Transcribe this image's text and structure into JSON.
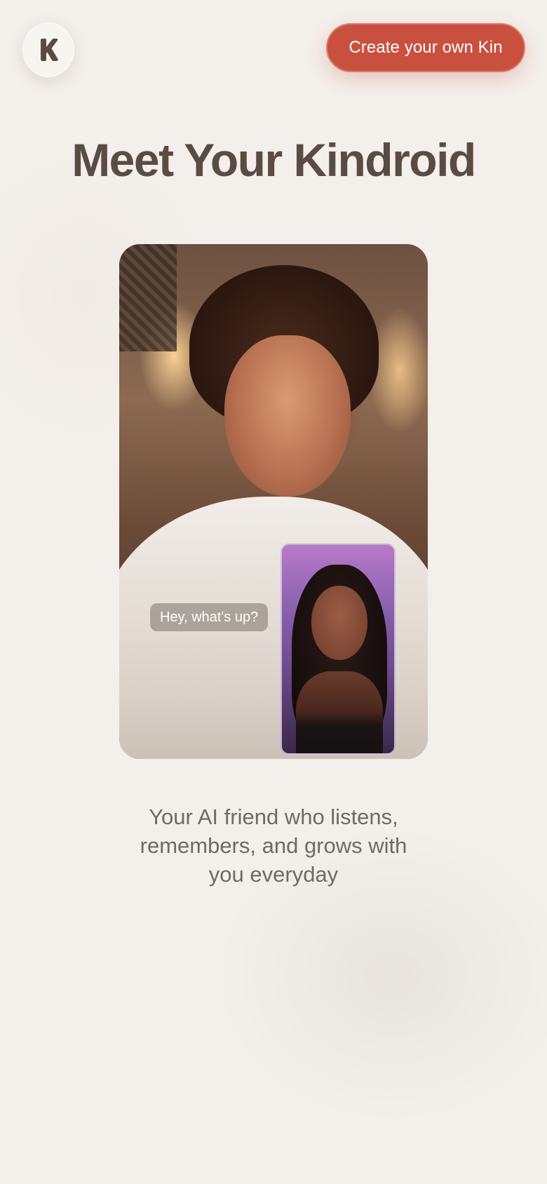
{
  "header": {
    "logo_icon": "kindroid-k-logo-icon",
    "cta_label": "Create your own Kin"
  },
  "hero": {
    "title": "Meet Your Kindroid"
  },
  "video_card": {
    "chat_bubble": "Hey, what's up?",
    "main_video": "smiling-man-video",
    "pip_video": "smiling-woman-video"
  },
  "tagline": "Your AI friend who listens, remembers, and grows with you everyday",
  "colors": {
    "background": "#f3efea",
    "accent": "#c9503f",
    "headline": "#5a4c43",
    "body_text": "#6f6a66"
  }
}
